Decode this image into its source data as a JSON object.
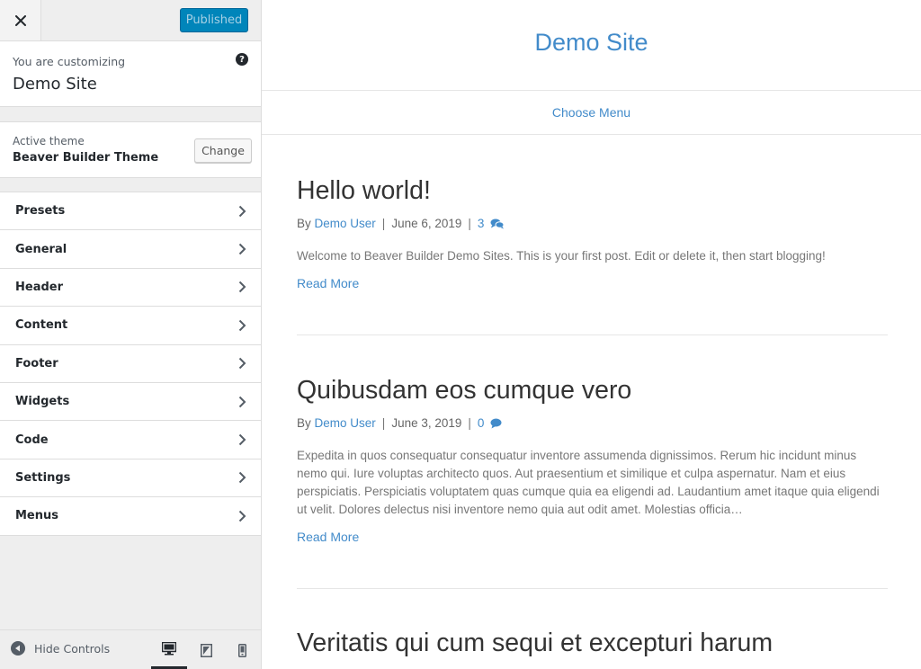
{
  "sidebar": {
    "publish_label": "Published",
    "customizing_label": "You are customizing",
    "site_name": "Demo Site",
    "active_theme_label": "Active theme",
    "theme_name": "Beaver Builder Theme",
    "change_label": "Change",
    "panels": [
      {
        "label": "Presets"
      },
      {
        "label": "General"
      },
      {
        "label": "Header"
      },
      {
        "label": "Content"
      },
      {
        "label": "Footer"
      },
      {
        "label": "Widgets"
      },
      {
        "label": "Code"
      },
      {
        "label": "Settings"
      },
      {
        "label": "Menus"
      }
    ],
    "hide_controls_label": "Hide Controls",
    "devices": [
      "desktop-icon",
      "tablet-icon",
      "mobile-icon"
    ],
    "active_device": "desktop"
  },
  "preview": {
    "site_title": "Demo Site",
    "menu_label": "Choose Menu",
    "posts": [
      {
        "title": "Hello world!",
        "by": "By",
        "author": "Demo User",
        "date": "June 6, 2019",
        "comments": "3",
        "excerpt": "Welcome to Beaver Builder Demo Sites. This is your first post. Edit or delete it, then start blogging!",
        "read_more": "Read More"
      },
      {
        "title": "Quibusdam eos cumque vero",
        "by": "By",
        "author": "Demo User",
        "date": "June 3, 2019",
        "comments": "0",
        "excerpt": "Expedita in quos consequatur consequatur inventore assumenda dignissimos. Rerum hic incidunt minus nemo qui. Iure voluptas architecto quos. Aut praesentium et similique et culpa aspernatur. Nam et eius perspiciatis. Perspiciatis voluptatem quas cumque quia ea eligendi ad. Laudantium amet itaque quia eligendi ut velit. Dolores delectus nisi inventore nemo quia aut odit amet. Molestias officia…",
        "read_more": "Read More"
      },
      {
        "title": "Veritatis qui cum sequi et excepturi harum"
      }
    ]
  },
  "colors": {
    "link": "#428bca",
    "publish_bg": "#0085ba",
    "sidebar_bg": "#eeeeee"
  }
}
